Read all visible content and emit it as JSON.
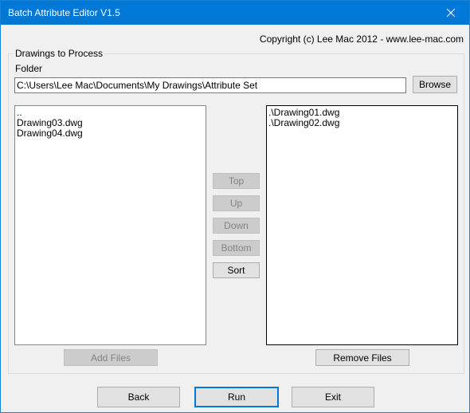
{
  "window": {
    "title": "Batch Attribute Editor V1.5",
    "close_icon": "close-icon"
  },
  "copyright": "Copyright (c) Lee Mac 2012  -  www.lee-mac.com",
  "group": {
    "label": "Drawings to Process",
    "folder_label": "Folder",
    "folder_value": "C:\\Users\\Lee Mac\\Documents\\My Drawings\\Attribute Set",
    "browse_label": "Browse"
  },
  "left_list": {
    "items": [
      "..",
      "Drawing03.dwg",
      "Drawing04.dwg"
    ],
    "add_files_label": "Add Files"
  },
  "right_list": {
    "items": [
      ".\\Drawing01.dwg",
      ".\\Drawing02.dwg"
    ],
    "remove_files_label": "Remove Files"
  },
  "order_buttons": {
    "top": "Top",
    "up": "Up",
    "down": "Down",
    "bottom": "Bottom",
    "sort": "Sort"
  },
  "footer": {
    "back": "Back",
    "run": "Run",
    "exit": "Exit"
  }
}
